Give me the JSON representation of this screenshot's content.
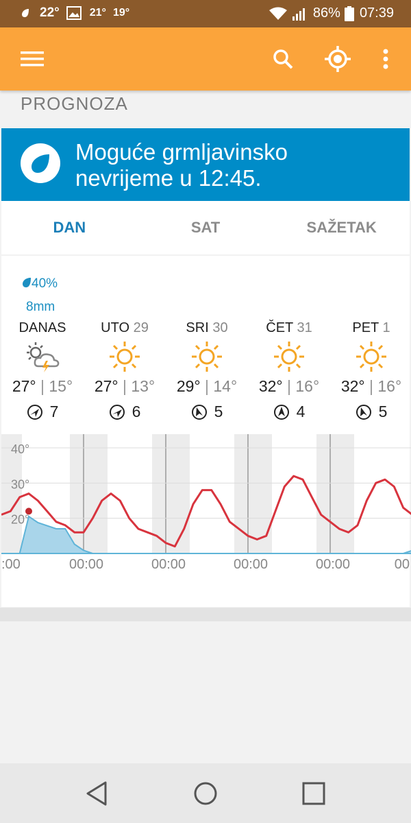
{
  "status_bar": {
    "temp_current": "22°",
    "temp_2": "21°",
    "temp_3": "19°",
    "battery": "86%",
    "time": "07:39"
  },
  "app_bar": {
    "menu_icon": "hamburger-icon",
    "search_icon": "search-icon",
    "location_icon": "location-target-icon",
    "more_icon": "more-vertical-icon",
    "color": "#fba43b"
  },
  "section_title": "PROGNOZA",
  "alert": {
    "line1": "Moguće grmljavinsko",
    "line2": "nevrijeme u 12:45.",
    "color": "#008cc8"
  },
  "tabs": [
    {
      "label": "DAN",
      "active": true
    },
    {
      "label": "SAT",
      "active": false
    },
    {
      "label": "SAŽETAK",
      "active": false
    }
  ],
  "precipitation": {
    "probability": "40%",
    "amount": "8mm"
  },
  "days": [
    {
      "name": "DANAS",
      "date": "",
      "icon": "thunderstorm-partly-sunny-icon",
      "max": "27°",
      "min": "15°",
      "wind": "7"
    },
    {
      "name": "UTO",
      "date": "29",
      "icon": "sun-icon",
      "max": "27°",
      "min": "13°",
      "wind": "6"
    },
    {
      "name": "SRI",
      "date": "30",
      "icon": "sun-icon",
      "max": "29°",
      "min": "14°",
      "wind": "5"
    },
    {
      "name": "ČET",
      "date": "31",
      "icon": "sun-icon",
      "max": "32°",
      "min": "16°",
      "wind": "4"
    },
    {
      "name": "PET",
      "date": "1",
      "icon": "sun-icon",
      "max": "32°",
      "min": "16°",
      "wind": "5"
    }
  ],
  "chart_data": {
    "type": "line",
    "y_tick_labels": [
      "40°",
      "30°",
      "20°"
    ],
    "x_tick_labels": [
      ":00",
      "00:00",
      "00:00",
      "00:00",
      "00:00",
      "00"
    ],
    "ylim": [
      10,
      40
    ],
    "series": [
      {
        "name": "",
        "kind": "temperature",
        "color": "#d8343e",
        "values": [
          21,
          22,
          26,
          27,
          25,
          22,
          19,
          18,
          16,
          16,
          20,
          25,
          27,
          25,
          20,
          17,
          16,
          15,
          13,
          12,
          17,
          24,
          28,
          28,
          24,
          19,
          17,
          15,
          14,
          15,
          22,
          29,
          32,
          31,
          26,
          21,
          19,
          17,
          16,
          18,
          25,
          30,
          31,
          29,
          23,
          21
        ]
      },
      {
        "name": "",
        "kind": "precipitation",
        "color": "#5fb4d8",
        "values": [
          0,
          0,
          0,
          12,
          10,
          9,
          8,
          8,
          3,
          1,
          0,
          0,
          0,
          0,
          0,
          0,
          0,
          0,
          0,
          0,
          0,
          0,
          0,
          0,
          0,
          0,
          0,
          0,
          0,
          0,
          0,
          0,
          0,
          0,
          0,
          0,
          0,
          0,
          0,
          0,
          0,
          0,
          0,
          0,
          0,
          1
        ]
      }
    ]
  }
}
